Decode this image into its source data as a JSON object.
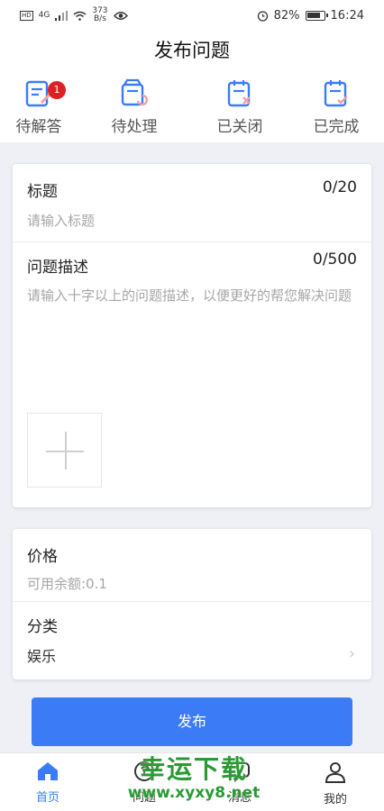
{
  "status_bar": {
    "network": "HD",
    "signal": "4G",
    "speed_value": "373",
    "speed_unit": "B/s",
    "battery": "82%",
    "time": "16:24"
  },
  "page": {
    "title": "发布问题"
  },
  "tabs": [
    {
      "label": "待解答",
      "badge": "1",
      "icon": "pending-answer-icon"
    },
    {
      "label": "待处理",
      "icon": "pending-process-icon"
    },
    {
      "label": "已关闭",
      "icon": "closed-icon"
    },
    {
      "label": "已完成",
      "icon": "completed-icon"
    }
  ],
  "form": {
    "title_label": "标题",
    "title_count": "0/20",
    "title_placeholder": "请输入标题",
    "desc_label": "问题描述",
    "desc_count": "0/500",
    "desc_placeholder": "请输入十字以上的问题描述，以便更好的帮您解决问题",
    "price_label": "价格",
    "price_placeholder": "可用余额:0.1",
    "category_label": "分类",
    "category_value": "娱乐"
  },
  "submit_label": "发布",
  "nav": [
    {
      "label": "首页",
      "icon": "home-icon",
      "active": true
    },
    {
      "label": "问题",
      "icon": "question-icon"
    },
    {
      "label": "消息",
      "icon": "message-icon"
    },
    {
      "label": "我的",
      "icon": "profile-icon"
    }
  ],
  "watermark": {
    "line1": "幸运下载",
    "line2": "www.xyxy8.net"
  },
  "colors": {
    "accent": "#3b7cf6",
    "badge": "#e02020",
    "watermark": "#2a9a34"
  }
}
